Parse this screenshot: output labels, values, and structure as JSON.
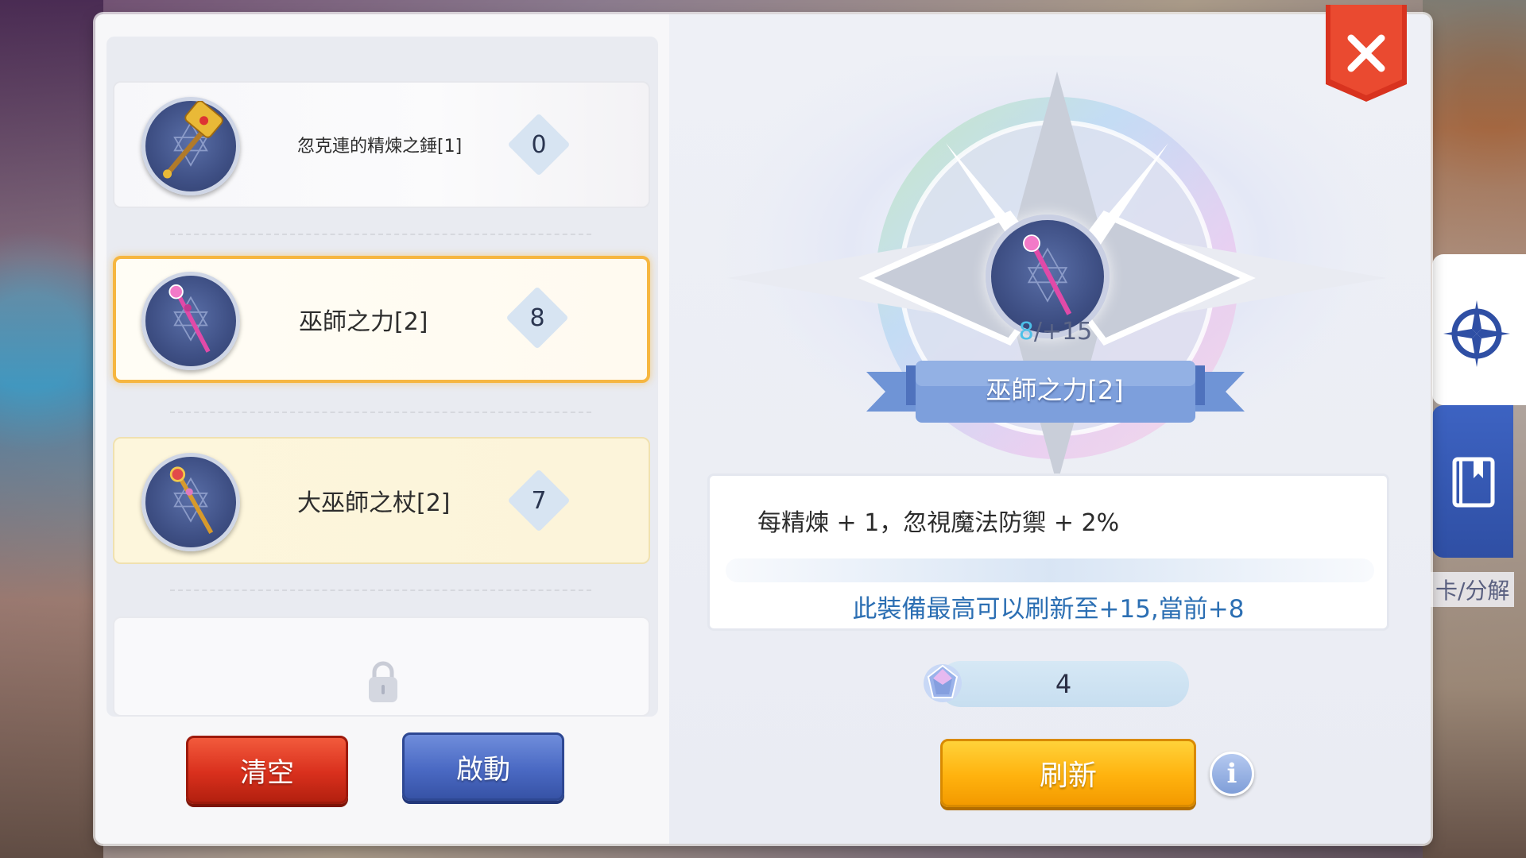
{
  "equipment_slots": [
    {
      "name": "忽克連的精煉之錘[1]",
      "value": "0",
      "state": "normal",
      "icon": "hammer-icon"
    },
    {
      "name": "巫師之力[2]",
      "value": "8",
      "state": "selected",
      "icon": "staff-pink-icon"
    },
    {
      "name": "大巫師之杖[2]",
      "value": "7",
      "state": "filled",
      "icon": "staff-gold-icon"
    },
    {
      "name": "",
      "value": "",
      "state": "locked",
      "icon": "lock-icon"
    }
  ],
  "buttons": {
    "clear": "清空",
    "activate": "啟動",
    "refresh": "刷新",
    "info": "i"
  },
  "selected_item": {
    "name": "巫師之力[2]",
    "current_level": "8",
    "max_level": "/+15",
    "description": "每精煉 + 1，忽視魔法防禦 + 2%",
    "note": "此裝備最高可以刷新至+15,當前+8"
  },
  "cost": {
    "amount": "4",
    "icon": "crystal-gem-icon"
  },
  "side_tab_label": "卡/分解",
  "colors": {
    "selected_border": "#f6b640",
    "note_text": "#2c6fb3",
    "clear_button": "#d9301d",
    "activate_button": "#4a69c3",
    "refresh_button": "#ffb20e",
    "close_button": "#d8331f"
  }
}
